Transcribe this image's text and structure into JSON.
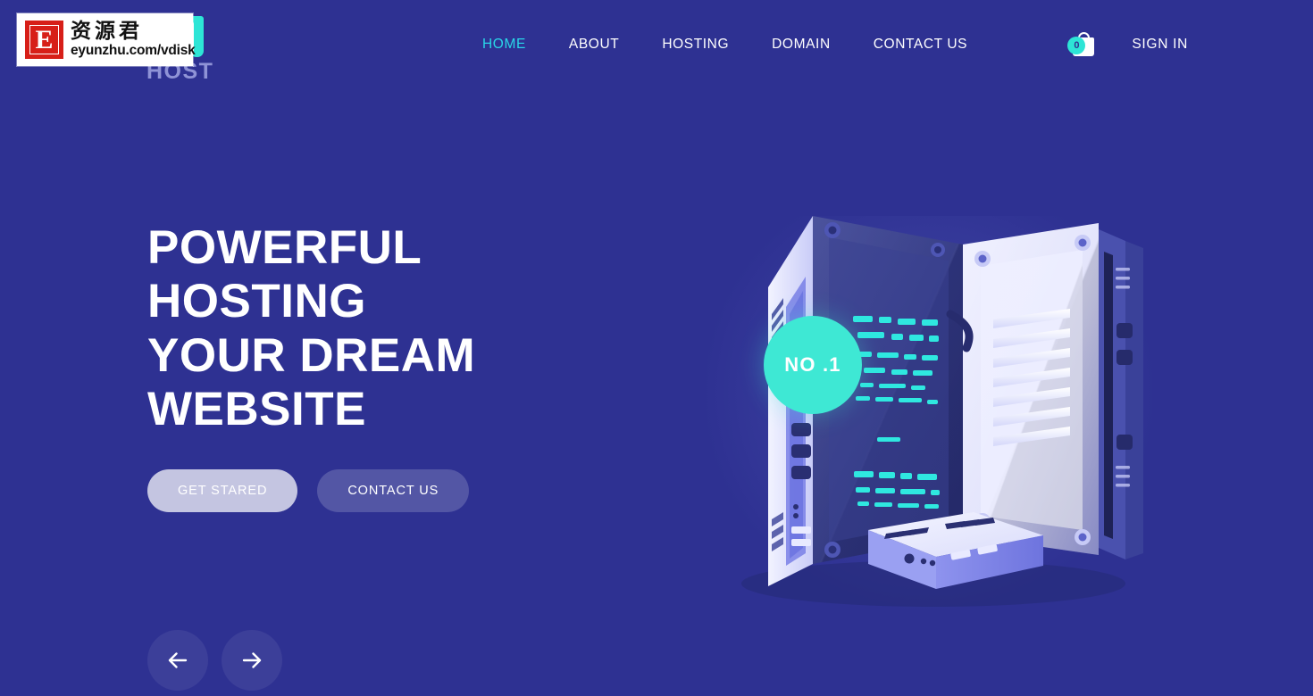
{
  "brand": {
    "text": "HOST",
    "mark_icon": "host-logo-mark",
    "accent_color": "#2DE5D6"
  },
  "nav": {
    "items": [
      {
        "label": "HOME",
        "active": true
      },
      {
        "label": "ABOUT",
        "active": false
      },
      {
        "label": "HOSTING",
        "active": false
      },
      {
        "label": "DOMAIN",
        "active": false
      },
      {
        "label": "CONTACT US",
        "active": false
      }
    ]
  },
  "header_right": {
    "cart_icon": "shopping-bag-icon",
    "cart_count": "0",
    "signin_label": "SIGN IN"
  },
  "hero": {
    "title_lines": [
      "POWERFUL",
      "HOSTING",
      "YOUR DREAM",
      "WEBSITE"
    ],
    "title_full": "POWERFUL HOSTING YOUR DREAM WEBSITE",
    "primary_button": "GET STARED",
    "secondary_button": "CONTACT US"
  },
  "slider": {
    "prev_icon": "arrow-left-icon",
    "next_icon": "arrow-right-icon"
  },
  "illustration": {
    "name": "server-racks-illustration",
    "badge_label": "NO .1",
    "badge_color": "#3EE8D4"
  },
  "watermark": {
    "logo_letter": "E",
    "chinese_text": "资源君",
    "url": "eyunzhu.com/vdisk",
    "logo_color": "#D71F18"
  },
  "theme": {
    "background": "#2E3192",
    "accent_cyan": "#29D6E8",
    "text_white": "#FFFFFF",
    "muted_brand": "#8F93D6"
  }
}
